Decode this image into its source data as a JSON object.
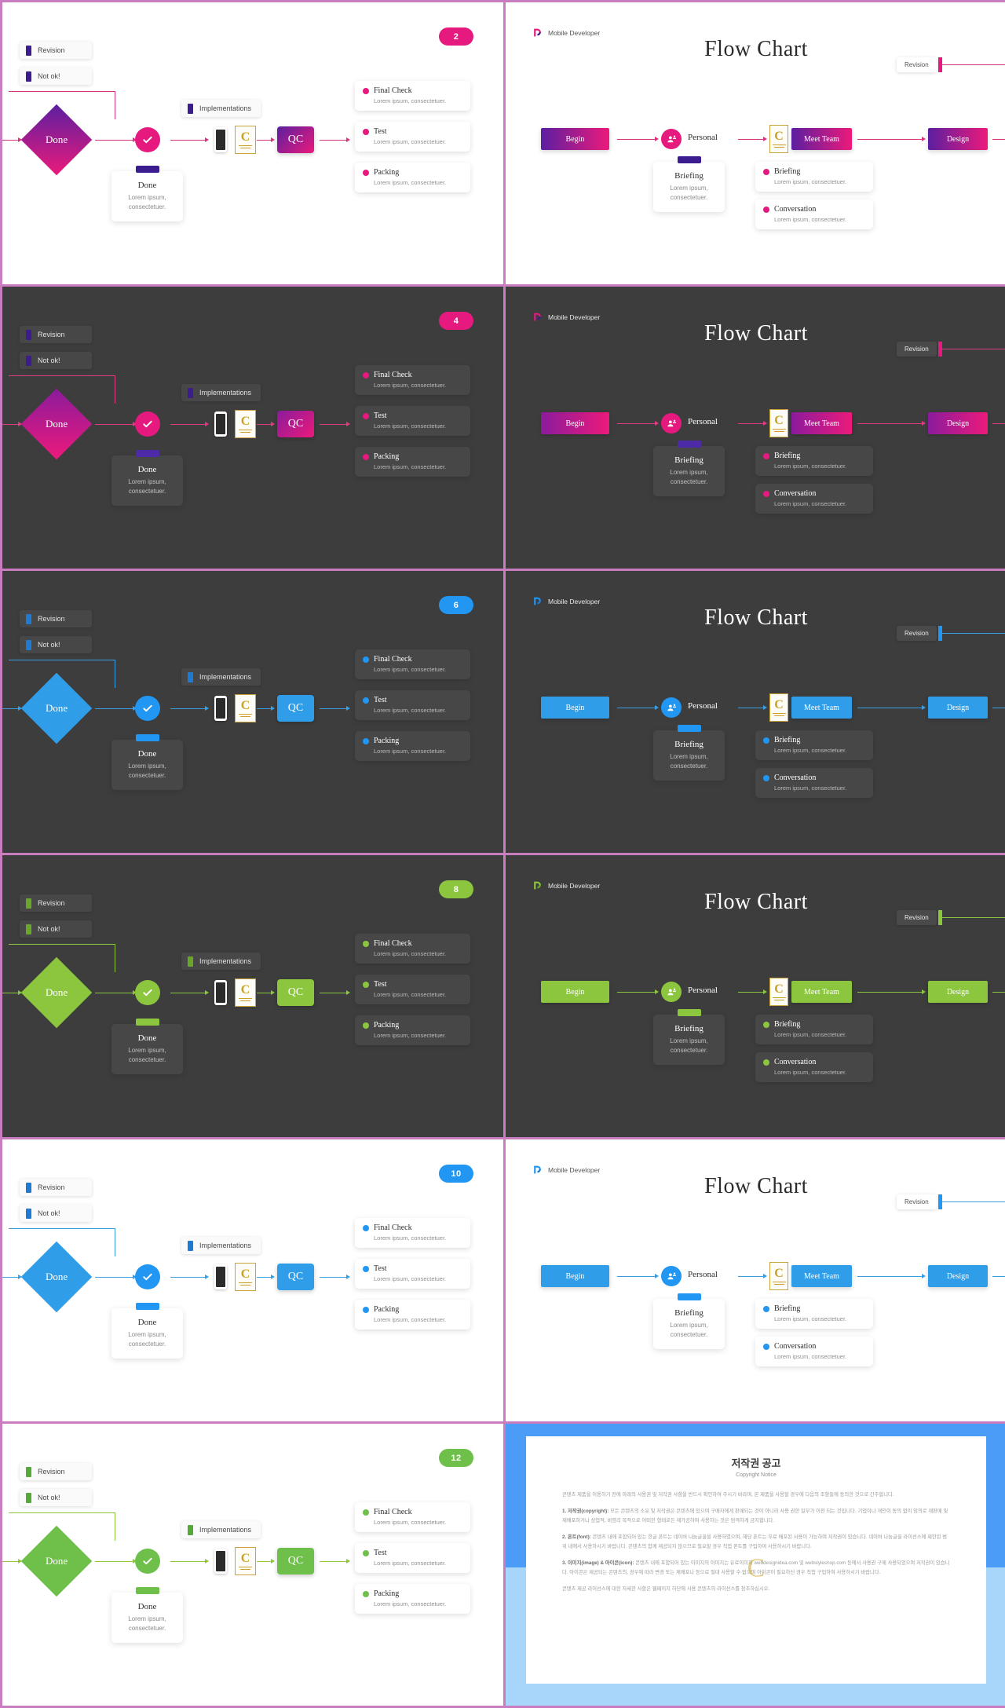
{
  "meta": {
    "frame_color": "#c97cc0",
    "slide_count": 12,
    "brand_name": "Mobile Developer"
  },
  "themes": [
    {
      "key": "t1",
      "badge": "2",
      "accent": "#e6197f",
      "accent2": "#3b1d8f",
      "grad_a": "#5b1fa0",
      "grad_b": "#ec1a7b",
      "arrow": "#d8337f",
      "note_tab": "#3b1d8f",
      "bg": "light",
      "circle": "#e6197f"
    },
    {
      "key": "t2",
      "badge": "4",
      "accent": "#e6197f",
      "accent2": "#3b1d8f",
      "grad_a": "#8b1b9c",
      "grad_b": "#ec1a7b",
      "arrow": "#e03b85",
      "note_tab": "#4c2aa8",
      "bg": "dark",
      "circle": "#e6197f"
    },
    {
      "key": "t3",
      "badge": "6",
      "accent": "#2196f3",
      "accent2": "#1f7ad4",
      "grad_a": "#2f9de8",
      "grad_b": "#2f9de8",
      "arrow": "#3a9fe0",
      "note_tab": "#2196f3",
      "bg": "dark",
      "circle": "#2196f3"
    },
    {
      "key": "t4",
      "badge": "8",
      "accent": "#8cc63e",
      "accent2": "#6aa62a",
      "grad_a": "#8cc63e",
      "grad_b": "#8cc63e",
      "arrow": "#8cc63e",
      "note_tab": "#8cc63e",
      "bg": "dark",
      "circle": "#8cc63e"
    },
    {
      "key": "t5",
      "badge": "10",
      "accent": "#2196f3",
      "accent2": "#1f7ad4",
      "grad_a": "#2f9de8",
      "grad_b": "#2f9de8",
      "arrow": "#3a9fe0",
      "note_tab": "#2196f3",
      "bg": "light",
      "circle": "#2196f3"
    },
    {
      "key": "t6",
      "badge": "12",
      "accent": "#6ec04a",
      "accent2": "#55a936",
      "grad_a": "#6ec04a",
      "grad_b": "#6ec04a",
      "arrow": "#8cc63e",
      "note_tab": "#6ec04a",
      "bg": "light",
      "circle": "#6ec04a"
    }
  ],
  "left_slide": {
    "legend": [
      {
        "label": "Revision"
      },
      {
        "label": "Not ok!"
      }
    ],
    "implementations_label": "Implementations",
    "diamond_label": "Done",
    "qc_label": "QC",
    "check_icon": "check-icon",
    "phone_icon": "smartphone-icon",
    "certificate_icon": "certificate-icon",
    "note": {
      "title": "Done",
      "body_line1": "Lorem ipsum,",
      "body_line2": "consectetuer."
    },
    "right_cards": [
      {
        "title": "Final  Check",
        "sub": "Lorem ipsum, consectetuer."
      },
      {
        "title": "Test",
        "sub": "Lorem ipsum, consectetuer."
      },
      {
        "title": "Packing",
        "sub": "Lorem ipsum, consectetuer."
      }
    ]
  },
  "right_slide": {
    "brand": "Mobile Developer",
    "title": "Flow Chart",
    "begin_label": "Begin",
    "personal_label": "Personal",
    "personal_icon": "user-group-icon",
    "meet_team_label": "Meet Team",
    "design_label": "Design",
    "revision_label": "Revision",
    "certificate_icon": "certificate-icon",
    "briefing_note": {
      "title": "Briefing",
      "body_line1": "Lorem ipsum,",
      "body_line2": "consectetuer."
    },
    "side_cards": [
      {
        "title": "Briefing",
        "sub": "Lorem ipsum, consectetuer."
      },
      {
        "title": "Conversation",
        "sub": "Lorem ipsum, consectetuer."
      }
    ]
  },
  "copyright_slide": {
    "title": "저작권 공고",
    "subtitle": "Copyright Notice",
    "intro": "콘텐츠 제품을 이용하기 전에 아래의 사용권 및 저작권 사항을 반드시 확인하여 주시기 바라며, 본 제품을 사용할 경우에 다음의 조항들에 동의한 것으로 간주합니다.",
    "sections": [
      {
        "heading": "1. 저작권(copyright):",
        "text": "모든 콘텐츠의 소유 및 저작권은 콘텐츠에 있으며 구매자에게 판매되는 것이 아니라 사용 권한 일부가 이전 되는 것입니다. 기업이나 개인이 동의 없이 임의로 재판매 및 재배포하거나 상업적, 비영리 목적으로 어떠한 형태로든 재가공하여 사용하는 것은 엄격하게 금지합니다."
      },
      {
        "heading": "2. 폰트(font):",
        "text": "콘텐츠 내에 포함되어 있는 한글 폰트는 네이버 나눔글꼴을 사용하였으며, 해당 폰트는 무료 배포된 사용이 가능하며 저작권이 있습니다. 네이버 나눔글꼴 라이선스에 제한된 범위 내에서 사용하시기 바랍니다. 콘텐츠의 함께 제공되지 않으므로 필요할 경우 직접 폰트를 구입하여 사용하시기 바랍니다."
      },
      {
        "heading": "3. 이미지(image) & 아이콘(icon):",
        "text": "콘텐츠 내에 포함되어 있는 이미지의 이미지는 유료이미지 webdesignidea.com 및 webstyleshop.com 등에서 사용권 구매 사용되었으며 저작권이 있습니다. 아이콘은 제공되는 콘텐츠의, 경우에 따라 변경 또는 재배포나 등으로 절대 사용할 수 없으며 아이콘이 필요하신 경우 직접 구입하여 사용하시기 바랍니다."
      }
    ],
    "footer": "콘텐츠 제공 라이선스에 대한 자세한 사항은 웹페이지 하단에 사용 콘텐츠의 라이선스를 참조하십시오."
  }
}
